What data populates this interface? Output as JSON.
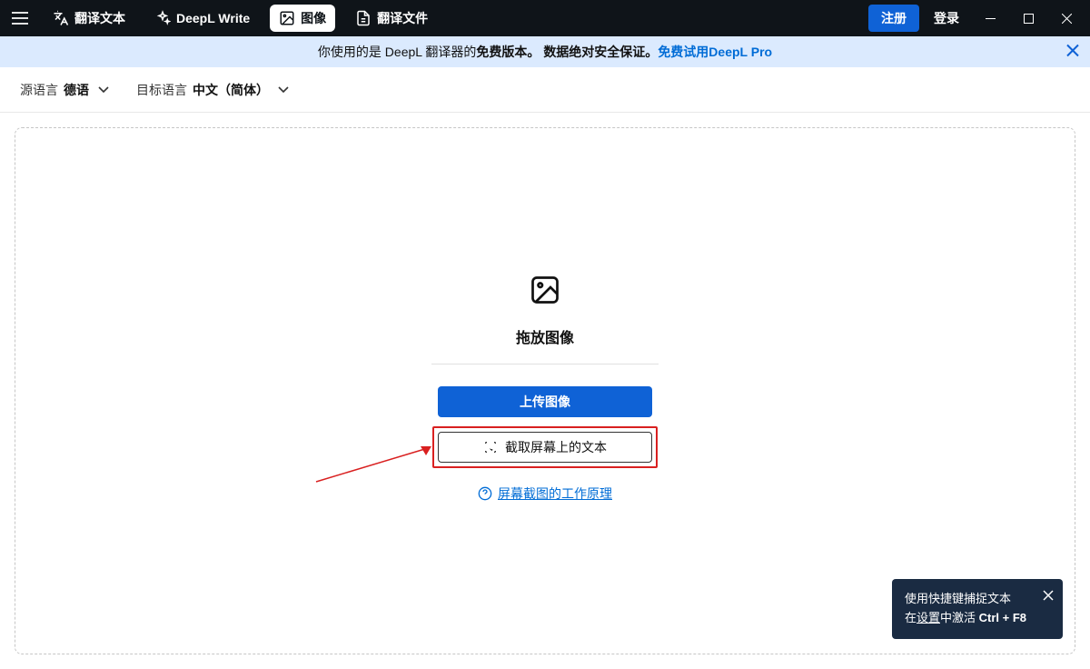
{
  "titlebar": {
    "tabs": {
      "translate_text": "翻译文本",
      "deepl_write": "DeepL Write",
      "image": "图像",
      "translate_file": "翻译文件"
    },
    "register": "注册",
    "login": "登录"
  },
  "banner": {
    "text_prefix": "你使用的是 DeepL 翻译器的",
    "text_bold1": "免费版本。",
    "text_bold2": "数据绝对安全保证。",
    "link": "免费试用DeepL Pro"
  },
  "lang_bar": {
    "source_label": "源语言",
    "source_value": "德语",
    "target_label": "目标语言",
    "target_value": "中文（简体）"
  },
  "dropzone": {
    "title": "拖放图像",
    "upload_btn": "上传图像",
    "capture_btn": "截取屏幕上的文本",
    "help_link": "屏幕截图的工作原理"
  },
  "toast": {
    "line1": "使用快捷键捕捉文本",
    "line2_prefix": "在",
    "line2_link": "设置",
    "line2_suffix": "中激活 ",
    "shortcut": "Ctrl + F8"
  },
  "colors": {
    "titlebar_bg": "#0f1419",
    "accent": "#0f62d6",
    "banner_bg": "#dbeafe",
    "highlight_border": "#d92020",
    "toast_bg": "#1a2b42"
  }
}
